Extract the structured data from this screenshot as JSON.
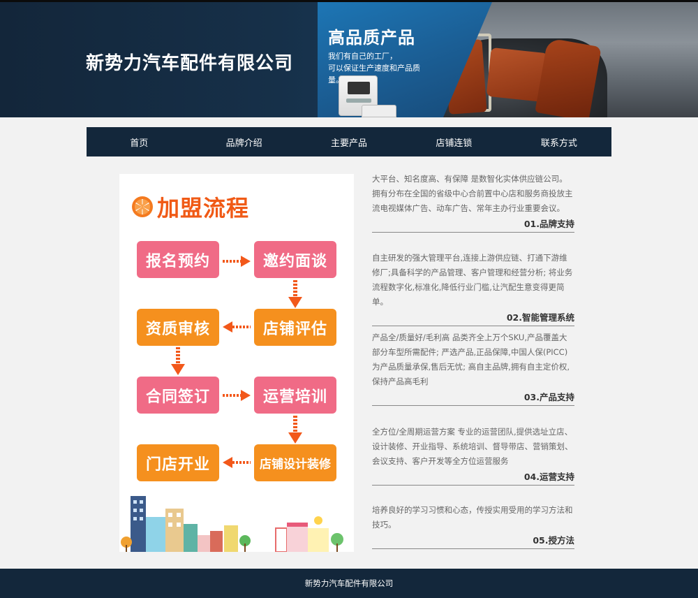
{
  "banner": {
    "company_name": "新势力汽车配件有限公司",
    "slogan": "高品质产品",
    "slogan_sub1": "我们有自己的工厂，",
    "slogan_sub2": "可以保证生产速度和产品质量。"
  },
  "nav": {
    "items": [
      {
        "label": "首页"
      },
      {
        "label": "品牌介绍"
      },
      {
        "label": "主要产品"
      },
      {
        "label": "店铺连锁"
      },
      {
        "label": "联系方式"
      }
    ]
  },
  "poster": {
    "title": "加盟流程",
    "steps": [
      {
        "label": "报名预约",
        "color": "pink"
      },
      {
        "label": "邀约面谈",
        "color": "pink"
      },
      {
        "label": "店铺评估",
        "color": "orange"
      },
      {
        "label": "资质审核",
        "color": "orange"
      },
      {
        "label": "合同签订",
        "color": "pink"
      },
      {
        "label": "运营培训",
        "color": "pink"
      },
      {
        "label": "店铺设计装修",
        "color": "orange"
      },
      {
        "label": "门店开业",
        "color": "orange"
      }
    ],
    "colors": {
      "pink": "#f06b86",
      "orange": "#f5901e",
      "arrow": "#f2581a",
      "title": "#f05a16"
    }
  },
  "features": [
    {
      "text": "大平台、知名度高、有保障 是数智化实体供应链公司。拥有分布在全国的省级中心合前置中心店和服务商投放主流电视媒体广告、动车广告、常年主办行业重要会议。",
      "title": "01.品牌支持"
    },
    {
      "text": "自主研发的强大管理平台,连接上游供应链、打通下游维修厂;具备科学的产品管理、客户管理和经营分析; 将业务流程数字化,标准化,降低行业门槛,让汽配生意变得更简单。",
      "title": "02.智能管理系统"
    },
    {
      "text": "产品全/质量好/毛利高 品类齐全上万个SKU,产品覆盖大部分车型所需配件; 严选产品,正品保障,中国人保(PICC)为产品质量承保,售后无忧; 高自主品牌,拥有自主定价权,保持产品高毛利",
      "title": "03.产品支持"
    },
    {
      "text": "全方位/全周期运营方案 专业的运营团队,提供选址立店、设计装修、开业指导、系统培训、督导带店、营销策划、会议支持、客户开发等全方位运营服务",
      "title": "04.运营支持"
    },
    {
      "text": "培养良好的学习习惯和心态，传授实用受用的学习方法和技巧。",
      "title": "05.授方法"
    }
  ],
  "footer": {
    "text": "新势力汽车配件有限公司"
  }
}
